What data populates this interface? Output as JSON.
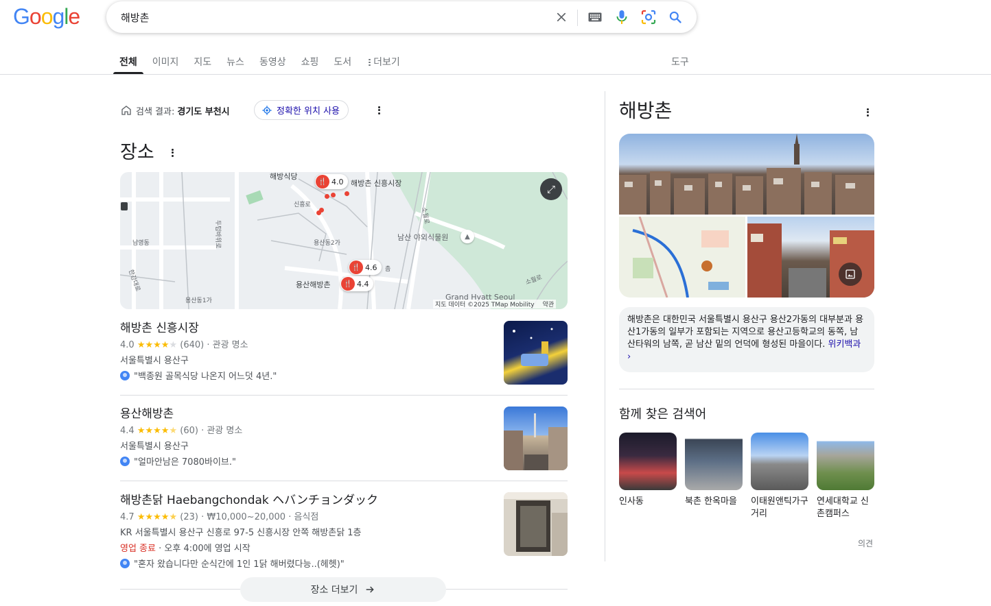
{
  "logo": "Google",
  "search": {
    "query": "해방촌"
  },
  "tabs": [
    "전체",
    "이미지",
    "지도",
    "뉴스",
    "동영상",
    "쇼핑",
    "도서",
    "더보기"
  ],
  "tools_label": "도구",
  "location": {
    "prefix": "검색 결과:",
    "place": "경기도 부천시",
    "precise_button": "정확한 위치 사용"
  },
  "places_title": "장소",
  "map": {
    "labels": [
      "해방식당",
      "해방촌 신흥시장",
      "신흥로",
      "용산동2가",
      "남산 야외식물원",
      "용산해방촌",
      "두텁바위로",
      "소월로",
      "소월로",
      "남영동",
      "한강대로",
      "용산동1가",
      "Grand Hyatt Seoul",
      "촘"
    ],
    "pins": [
      "4.0",
      "4.6",
      "4.4"
    ],
    "attribution": "지도 데이터 ©2025 TMap Mobility",
    "terms": "약관"
  },
  "places": [
    {
      "name": "해방촌 신흥시장",
      "rating": "4.0",
      "stars_full": 4,
      "reviews": "(640)",
      "category": "· 관광 명소",
      "address": "서울특별시 용산구",
      "review": "\"백종원 골목식당 나온지 어느덧 4년.\""
    },
    {
      "name": "용산해방촌",
      "rating": "4.4",
      "stars_full": 4,
      "reviews": "(60)",
      "category": "· 관광 명소",
      "address": "서울특별시 용산구",
      "review": "\"얼마안남은 7080바이브.\""
    },
    {
      "name": "해방촌닭 Haebangchondak ヘバンチョンダック",
      "rating": "4.7",
      "stars_full": 4,
      "reviews": "(23)",
      "category": "· ₩10,000~20,000 · 음식점",
      "address": "KR 서울특별시 용산구 신흥로 97-5 신흥시장 안쪽 해방촌닭 1층",
      "status_closed": "영업 종료",
      "status_hours": "· 오후 4:00에 영업 시작",
      "review": "\"혼자 왔습니다만 순식간에 1인 1닭 해버렸다능..(헤헷)\""
    }
  ],
  "more_places": "장소 더보기",
  "knowledge_panel": {
    "title": "해방촌",
    "description": "해방촌은 대한민국 서울특별시 용산구 용산2가동의 대부분과 용산1가동의 일부가 포함되는 지역으로 용산고등학교의 동쪽, 남산타워의 남쪽, 곧 남산 밑의 언덕에 형성된 마을이다.",
    "wiki_link": "위키백과 ›",
    "related_title": "함께 찾은 검색어",
    "related": [
      "인사동",
      "북촌 한옥마을",
      "이태원앤틱가구거리",
      "연세대학교 신촌캠퍼스"
    ],
    "feedback": "의견"
  },
  "colors": {
    "accent": "#1a0dab",
    "star": "#fbbc04",
    "closed": "#d93025",
    "pin": "#ea4335"
  }
}
